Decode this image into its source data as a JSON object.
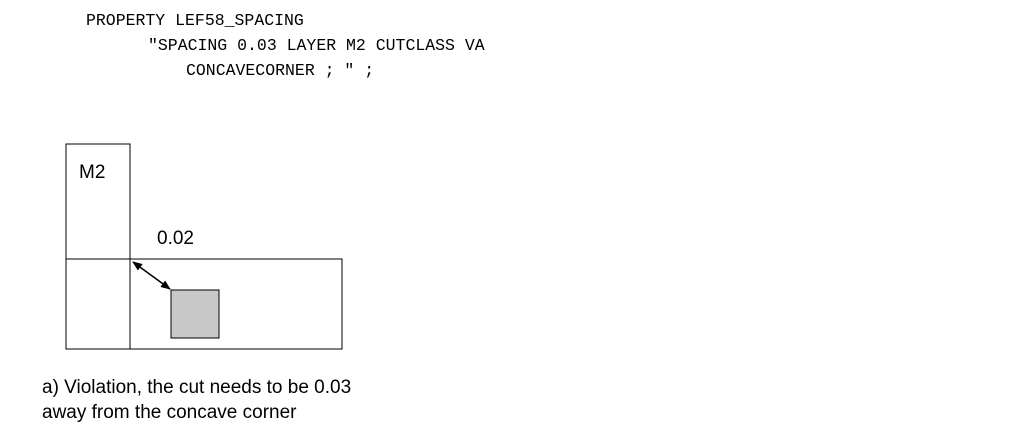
{
  "code": {
    "line1": "PROPERTY LEF58_SPACING",
    "line2": "\"SPACING 0.03 LAYER M2 CUTCLASS VA",
    "line3": "CONCAVECORNER ; \" ;"
  },
  "diagram": {
    "layer_label": "M2",
    "distance_label": "0.02",
    "fill_color": "#c8c8c8"
  },
  "caption": {
    "line1": "a) Violation, the cut needs to be 0.03",
    "line2": "away from the concave corner"
  }
}
